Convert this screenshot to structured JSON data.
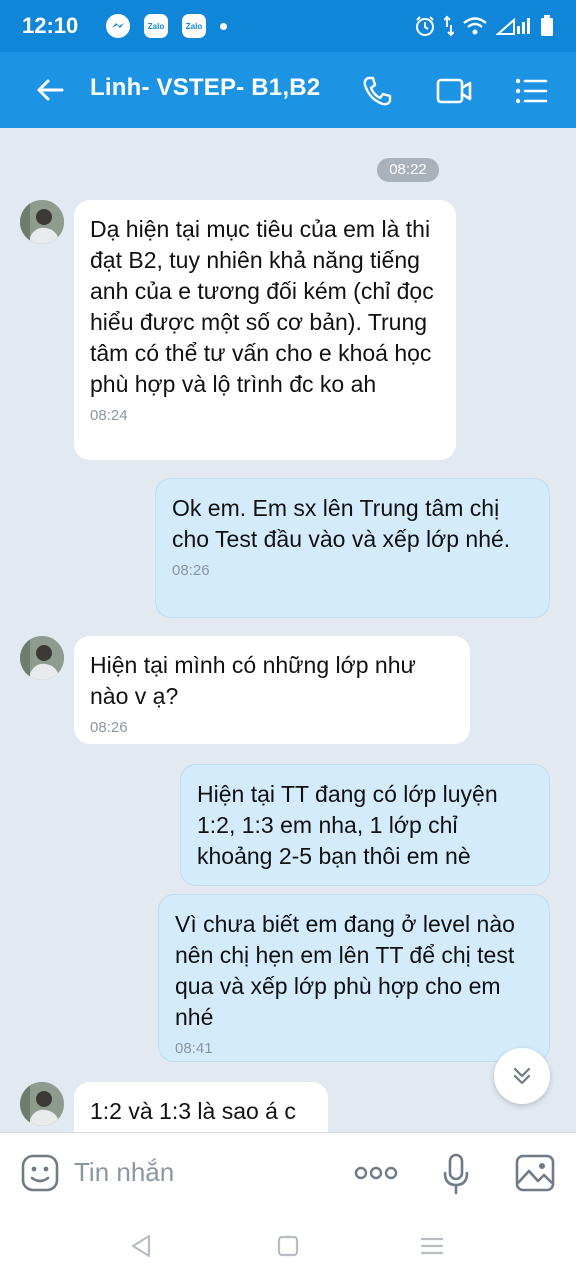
{
  "status_bar": {
    "time": "12:10",
    "app_icons": [
      "messenger-icon",
      "zalo-icon",
      "zalo-icon"
    ],
    "app_label_1": "Zalo",
    "app_label_2": "Zalo",
    "right_icons": [
      "alarm-icon",
      "data-arrows-icon",
      "wifi-icon",
      "signal-icon",
      "battery-icon"
    ]
  },
  "header": {
    "title": "Linh- VSTEP- B1,B2",
    "icons": [
      "back-arrow-icon",
      "phone-icon",
      "video-call-icon",
      "menu-icon"
    ]
  },
  "chat": {
    "date_chip": "08:22",
    "messages": [
      {
        "direction": "in",
        "text": "Dạ hiện tại mục tiêu của em là thi đạt B2, tuy nhiên khả năng tiếng anh của e tương đối kém (chỉ đọc hiểu được một số cơ bản). Trung tâm có thể tư vấn cho e khoá học phù hợp và lộ trình đc ko ah",
        "time": "08:24"
      },
      {
        "direction": "out",
        "text": "Ok em. Em sx lên Trung tâm chị cho Test đầu vào và xếp lớp nhé.",
        "time": "08:26"
      },
      {
        "direction": "in",
        "text": "Hiện tại mình có những lớp như nào v ạ?",
        "time": "08:26"
      },
      {
        "direction": "out",
        "text": "Hiện tại TT đang có lớp luyện 1:2, 1:3 em nha, 1 lớp chỉ khoảng 2-5 bạn thôi em nè",
        "time": ""
      },
      {
        "direction": "out",
        "text": "Vì chưa biết em đang ở level nào nên chị hẹn em lên TT để chị test qua và xếp lớp phù hợp cho em nhé",
        "time": "08:41"
      },
      {
        "direction": "in",
        "text": "1:2 và 1:3 là sao á c",
        "time": ""
      }
    ]
  },
  "input_bar": {
    "placeholder": "Tin nhắn",
    "icons": [
      "sticker-icon",
      "more-icon",
      "microphone-icon",
      "image-icon"
    ]
  },
  "nav_bar": {
    "icons": [
      "nav-back-icon",
      "nav-home-icon",
      "nav-recents-icon"
    ]
  },
  "colors": {
    "header_bg": "#1c93e3",
    "status_bg": "#0f86d8",
    "chat_bg": "#e2e9f1",
    "incoming_bubble": "#ffffff",
    "outgoing_bubble": "#d3ebfb"
  }
}
